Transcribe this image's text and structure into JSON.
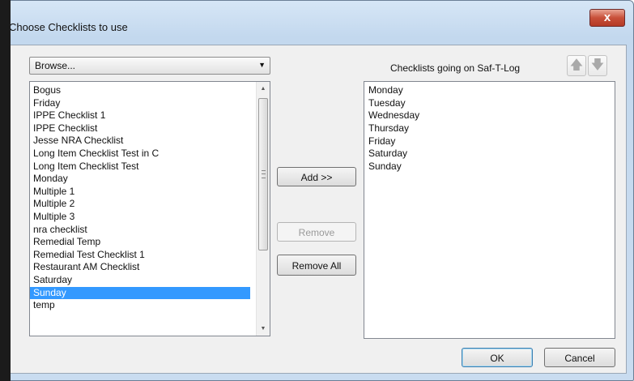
{
  "window": {
    "title": "Choose Checklists to use",
    "close_symbol": "x"
  },
  "browse": {
    "selected": "Browse..."
  },
  "available_list": {
    "items": [
      "Bogus",
      "Friday",
      "IPPE Checklist 1",
      "IPPE Checklist",
      "Jesse NRA Checklist",
      "Long Item Checklist Test in C",
      "Long Item Checklist Test",
      "Monday",
      "Multiple 1",
      "Multiple 2",
      "Multiple 3",
      "nra checklist",
      "Remedial Temp",
      "Remedial Test Checklist 1",
      "Restaurant AM Checklist",
      "Saturday",
      "Sunday",
      "temp"
    ],
    "selected": "Sunday"
  },
  "buttons": {
    "add": "Add >>",
    "remove": "Remove",
    "remove_all": "Remove All",
    "ok": "OK",
    "cancel": "Cancel"
  },
  "selected_list": {
    "label": "Checklists going on Saf-T-Log",
    "items": [
      "Monday",
      "Tuesday",
      "Wednesday",
      "Thursday",
      "Friday",
      "Saturday",
      "Sunday"
    ]
  },
  "icons": {
    "move_up": "arrow-up-icon",
    "move_down": "arrow-down-icon",
    "dropdown": "chevron-down-icon",
    "close": "close-icon"
  },
  "colors": {
    "selection": "#3399ff",
    "close_button": "#c8503a"
  }
}
